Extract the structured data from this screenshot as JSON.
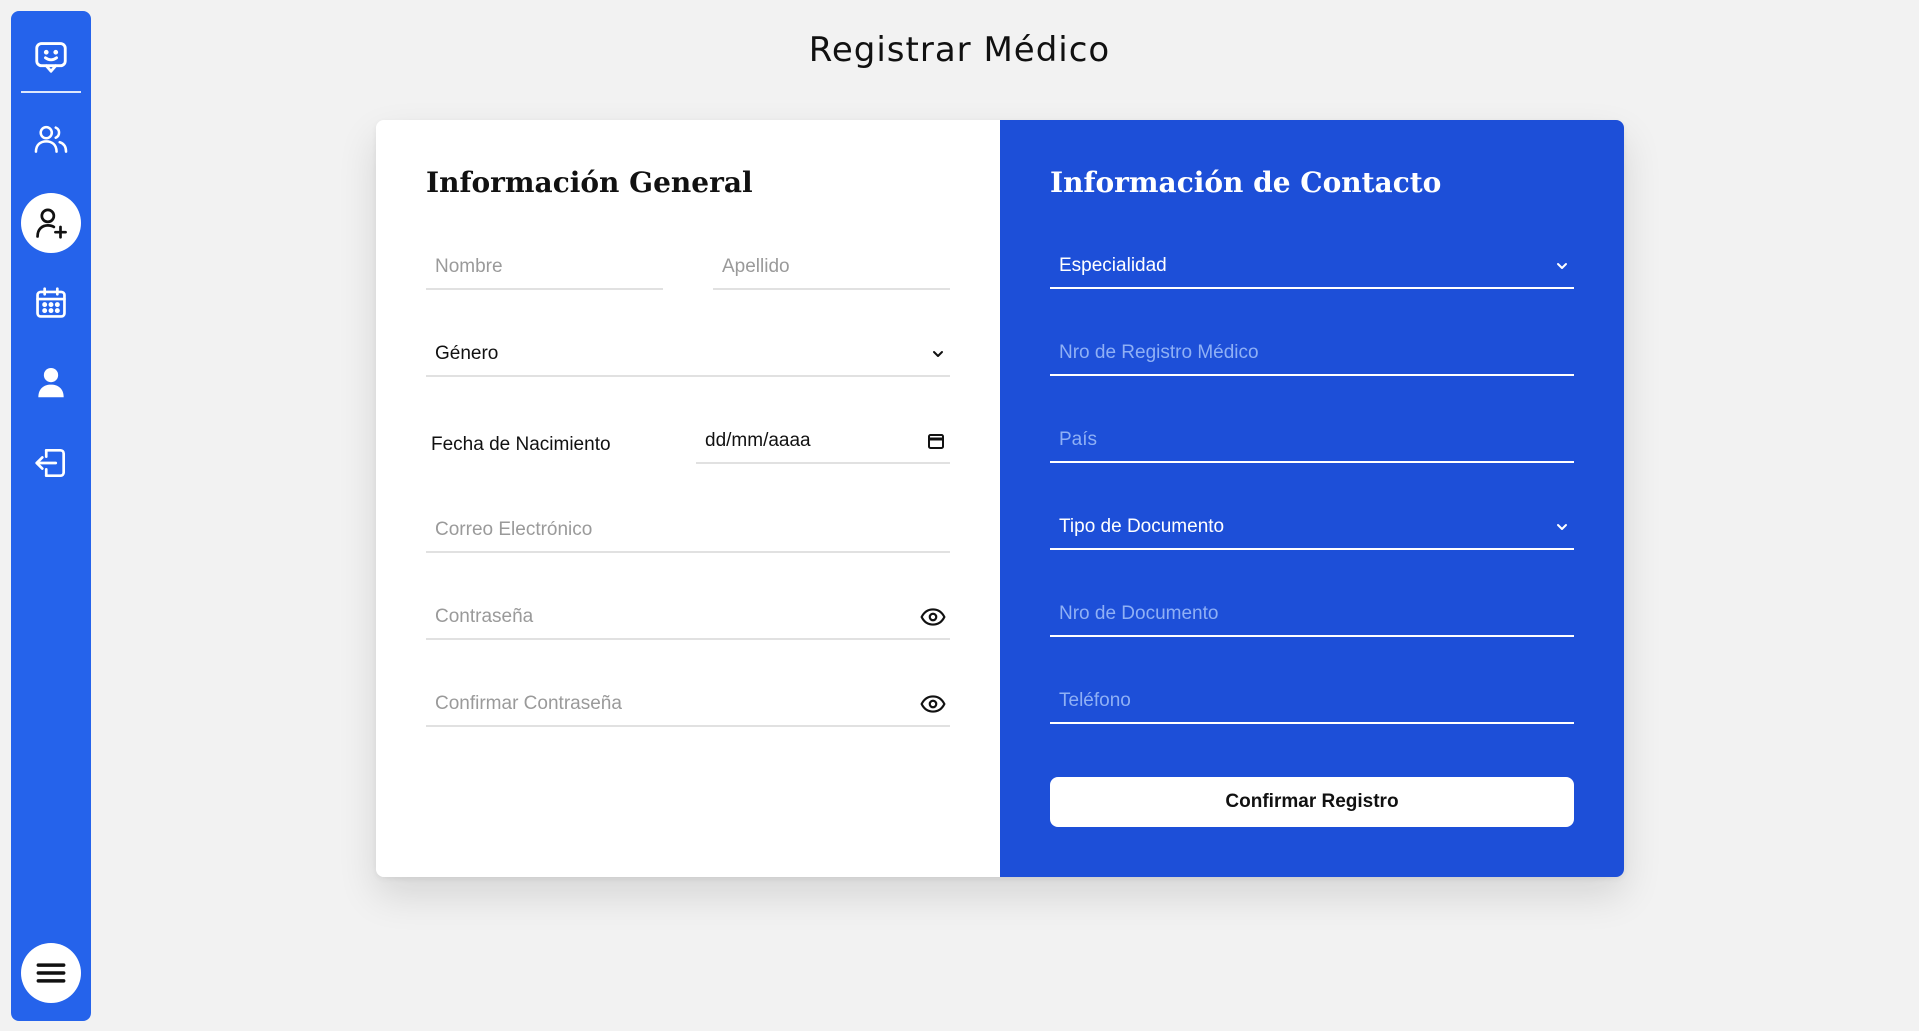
{
  "page": {
    "title": "Registrar Médico"
  },
  "colors": {
    "sidebar": "#2563eb",
    "contact_panel": "#1d4fd8",
    "background": "#f2f2f2"
  },
  "sidebar": {
    "items": [
      {
        "icon": "chat-icon"
      },
      {
        "icon": "users-icon"
      },
      {
        "icon": "user-plus-icon",
        "active": true
      },
      {
        "icon": "calendar-icon"
      },
      {
        "icon": "user-icon"
      },
      {
        "icon": "logout-icon"
      },
      {
        "icon": "menu-icon"
      }
    ]
  },
  "general": {
    "title": "Información General",
    "nombre_placeholder": "Nombre",
    "apellido_placeholder": "Apellido",
    "genero_label": "Género",
    "fecha_label": "Fecha de Nacimiento",
    "fecha_value": "dd/mm/aaaa",
    "correo_placeholder": "Correo Electrónico",
    "password_placeholder": "Contraseña",
    "confirm_password_placeholder": "Confirmar Contraseña"
  },
  "contact": {
    "title": "Información de Contacto",
    "especialidad_label": "Especialidad",
    "registro_placeholder": "Nro de Registro Médico",
    "pais_placeholder": "País",
    "tipo_doc_label": "Tipo de Documento",
    "nro_doc_placeholder": "Nro de Documento",
    "telefono_placeholder": "Teléfono",
    "submit_label": "Confirmar Registro"
  }
}
